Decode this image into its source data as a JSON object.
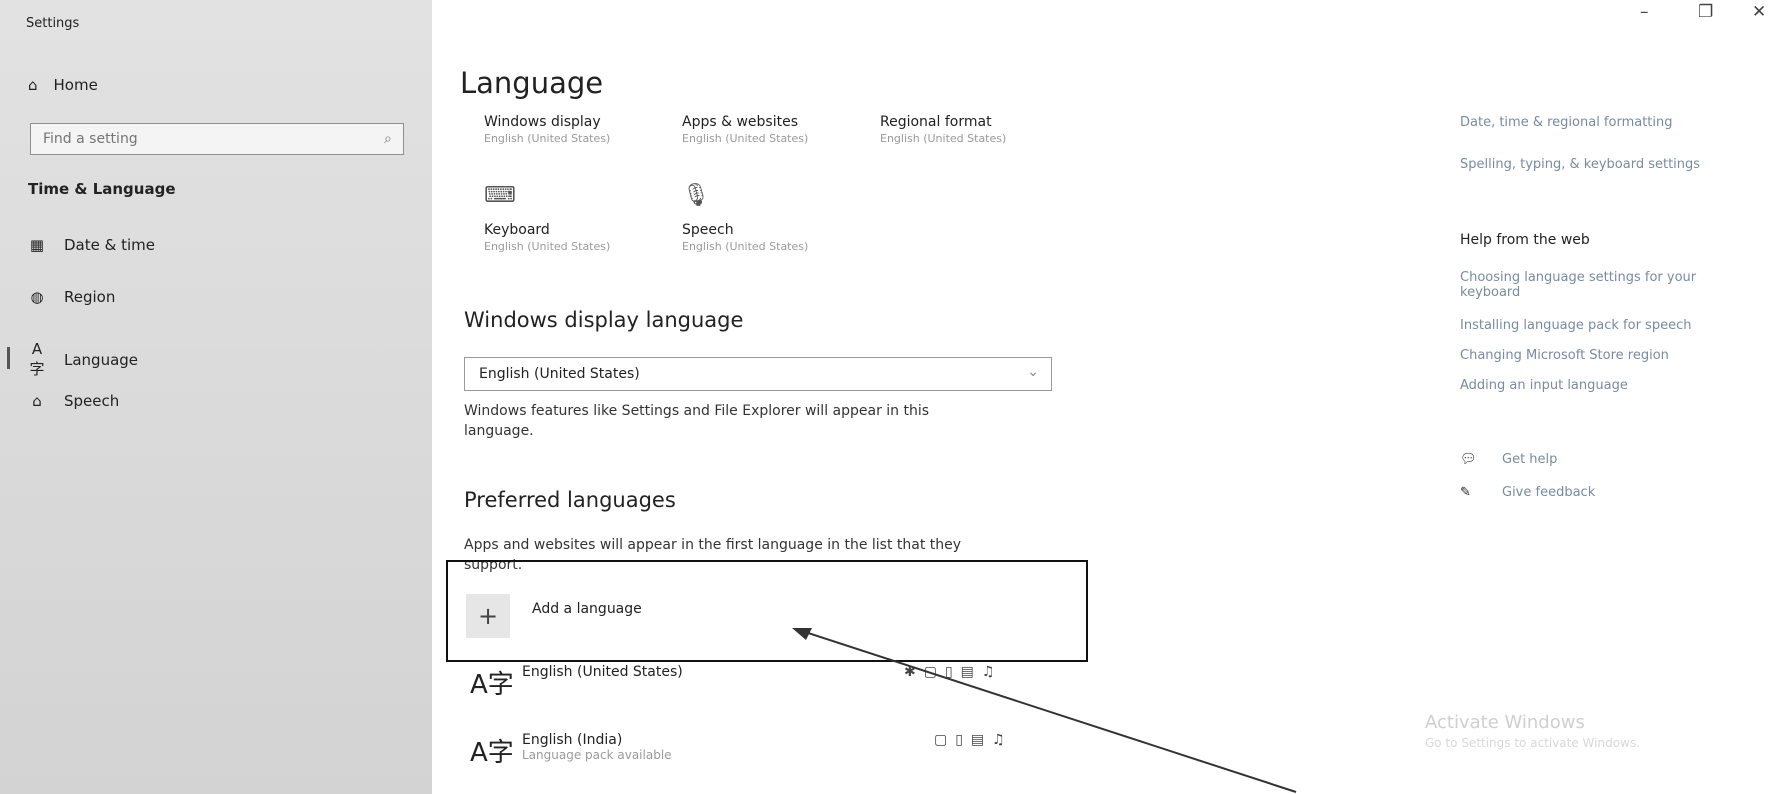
{
  "app_title": "Settings",
  "window": {
    "minimize": "–",
    "restore": "❐",
    "close": "✕"
  },
  "sidebar": {
    "home": "Home",
    "search_placeholder": "Find a setting",
    "group_title": "Time & Language",
    "items": [
      {
        "label": "Date & time",
        "icon": "calendar-clock-icon"
      },
      {
        "label": "Region",
        "icon": "globe-icon"
      },
      {
        "label": "Language",
        "icon": "language-icon"
      },
      {
        "label": "Speech",
        "icon": "microphone-icon"
      }
    ],
    "selected": "Language"
  },
  "main": {
    "title": "Language",
    "tiles": [
      {
        "title": "Windows display",
        "sub": "English (United States)"
      },
      {
        "title": "Apps & websites",
        "sub": "English (United States)"
      },
      {
        "title": "Regional format",
        "sub": "English (United States)"
      },
      {
        "title": "Keyboard",
        "sub": "English (United States)",
        "icon": "keyboard-icon"
      },
      {
        "title": "Speech",
        "sub": "English (United States)",
        "icon": "microphone-icon"
      }
    ],
    "display_language": {
      "heading": "Windows display language",
      "selected": "English (United States)",
      "description_line1": "Windows features like Settings and File Explorer will appear in this",
      "description_line2": "language."
    },
    "preferred": {
      "heading": "Preferred languages",
      "description_line1": "Apps and websites will appear in the first language in the list that they",
      "description_line2": "support.",
      "add_label": "Add a language",
      "languages": [
        {
          "name": "English (United States)",
          "sub": ""
        },
        {
          "name": "English (India)",
          "sub": "Language pack available"
        }
      ]
    }
  },
  "right": {
    "related": [
      "Date, time & regional formatting",
      "Spelling, typing, & keyboard settings"
    ],
    "help_heading": "Help from the web",
    "help_links": [
      "Choosing language settings for your keyboard",
      "Installing language pack for speech",
      "Changing Microsoft Store region",
      "Adding an input language"
    ],
    "get_help": "Get help",
    "give_feedback": "Give feedback",
    "watermark_title": "Activate Windows",
    "watermark_sub": "Go to Settings to activate Windows."
  }
}
